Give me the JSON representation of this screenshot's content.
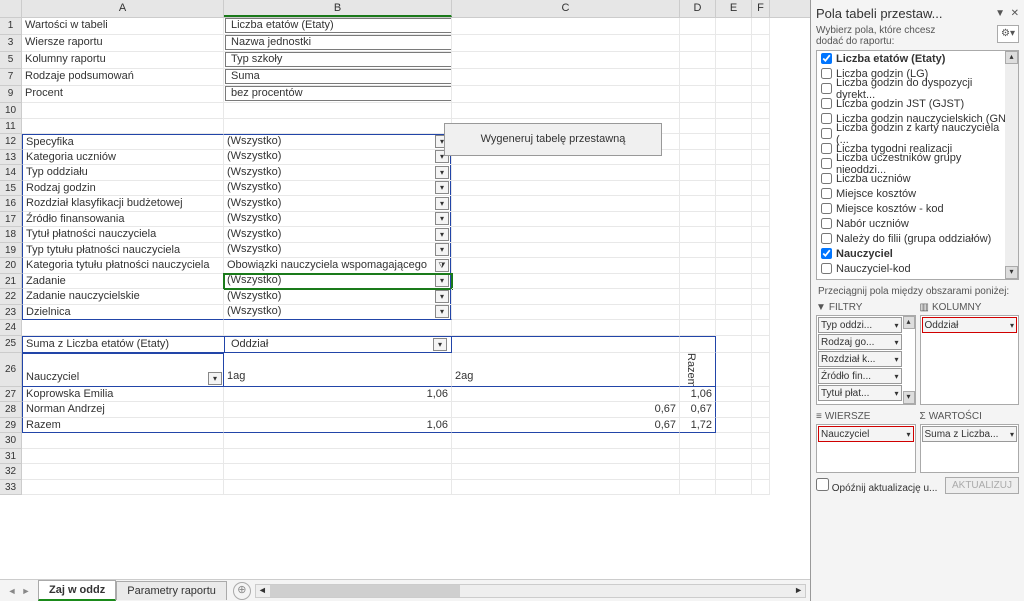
{
  "columns": [
    "A",
    "B",
    "C",
    "D",
    "E",
    "F"
  ],
  "params": {
    "r1": {
      "label": "Wartości w tabeli",
      "value": "Liczba etatów (Etaty)"
    },
    "r3": {
      "label": "Wiersze raportu",
      "value": "Nazwa jednostki"
    },
    "r5": {
      "label": "Kolumny raportu",
      "value": "Typ szkoły"
    },
    "r7": {
      "label": "Rodzaje podsumowań",
      "value": "Suma"
    },
    "r9": {
      "label": "Procent",
      "value": "bez procentów"
    }
  },
  "gen_button": "Wygeneruj tabelę przestawną",
  "filters": [
    {
      "n": 12,
      "label": "Specyfika",
      "val": "(Wszystko)"
    },
    {
      "n": 13,
      "label": "Kategoria uczniów",
      "val": "(Wszystko)"
    },
    {
      "n": 14,
      "label": "Typ oddziału",
      "val": "(Wszystko)"
    },
    {
      "n": 15,
      "label": "Rodzaj godzin",
      "val": "(Wszystko)"
    },
    {
      "n": 16,
      "label": "Rozdział klasyfikacji budżetowej",
      "val": "(Wszystko)"
    },
    {
      "n": 17,
      "label": "Źródło finansowania",
      "val": "(Wszystko)"
    },
    {
      "n": 18,
      "label": "Tytuł płatności nauczyciela",
      "val": "(Wszystko)"
    },
    {
      "n": 19,
      "label": "Typ tytułu płatności nauczyciela",
      "val": "(Wszystko)"
    },
    {
      "n": 20,
      "label": "Kategoria tytułu płatności nauczyciela",
      "val": "Obowiązki nauczyciela wspomagającego",
      "funnel": true
    },
    {
      "n": 21,
      "label": "Zadanie",
      "val": "(Wszystko)",
      "selected": true
    },
    {
      "n": 22,
      "label": "Zadanie nauczycielskie",
      "val": "(Wszystko)"
    },
    {
      "n": 23,
      "label": "Dzielnica",
      "val": "(Wszystko)"
    }
  ],
  "pivot_header": {
    "row25a": "Suma z Liczba etatów (Etaty)",
    "row25b": "Oddział",
    "row26a": "Nauczyciel",
    "colB": "1ag",
    "colC": "2ag",
    "colD": "Razem"
  },
  "pivot_rows": [
    {
      "n": 27,
      "a": "Koprowska Emilia",
      "b": "1,06",
      "c": "",
      "d": "1,06"
    },
    {
      "n": 28,
      "a": "Norman Andrzej",
      "b": "",
      "c": "0,67",
      "d": "0,67"
    },
    {
      "n": 29,
      "a": "Razem",
      "b": "1,06",
      "c": "0,67",
      "d": "1,72"
    }
  ],
  "empty_rows": [
    24,
    30,
    31,
    32,
    33
  ],
  "sheet_tabs": {
    "active": "Zaj w oddz",
    "other": "Parametry raportu"
  },
  "pane": {
    "title": "Pola tabeli przestaw...",
    "subtitle": "Wybierz pola, które chcesz dodać do raportu:",
    "fields": [
      {
        "label": "Liczba etatów (Etaty)",
        "checked": true,
        "bold": true
      },
      {
        "label": "Liczba godzin (LG)",
        "checked": false
      },
      {
        "label": "Liczba godzin do dyspozycji dyrekt...",
        "checked": false
      },
      {
        "label": "Liczba godzin JST (GJST)",
        "checked": false
      },
      {
        "label": "Liczba godzin nauczycielskich (GN)",
        "checked": false
      },
      {
        "label": "Liczba godzin z karty nauczyciela (...",
        "checked": false
      },
      {
        "label": "Liczba tygodni realizacji",
        "checked": false
      },
      {
        "label": "Liczba uczestników grupy nieoddzi...",
        "checked": false
      },
      {
        "label": "Liczba uczniów",
        "checked": false
      },
      {
        "label": "Miejsce kosztów",
        "checked": false
      },
      {
        "label": "Miejsce kosztów - kod",
        "checked": false
      },
      {
        "label": "Nabór uczniów",
        "checked": false
      },
      {
        "label": "Należy do filii (grupa oddziałów)",
        "checked": false
      },
      {
        "label": "Nauczyciel",
        "checked": true,
        "bold": true
      },
      {
        "label": "Nauczyciel-kod",
        "checked": false
      }
    ],
    "drag_hint": "Przeciągnij pola między obszarami poniżej:",
    "areas": {
      "filters_title": "FILTRY",
      "columns_title": "KOLUMNY",
      "rows_title": "WIERSZE",
      "values_title": "WARTOŚCI",
      "filters": [
        "Typ oddzi...",
        "Rodzaj go...",
        "Rozdział k...",
        "Źródło fin...",
        "Tytuł płat..."
      ],
      "columns": [
        "Oddział"
      ],
      "rows": [
        "Nauczyciel"
      ],
      "values": [
        "Suma z Liczba..."
      ]
    },
    "defer": "Opóźnij aktualizację u...",
    "update": "AKTUALIZUJ"
  }
}
